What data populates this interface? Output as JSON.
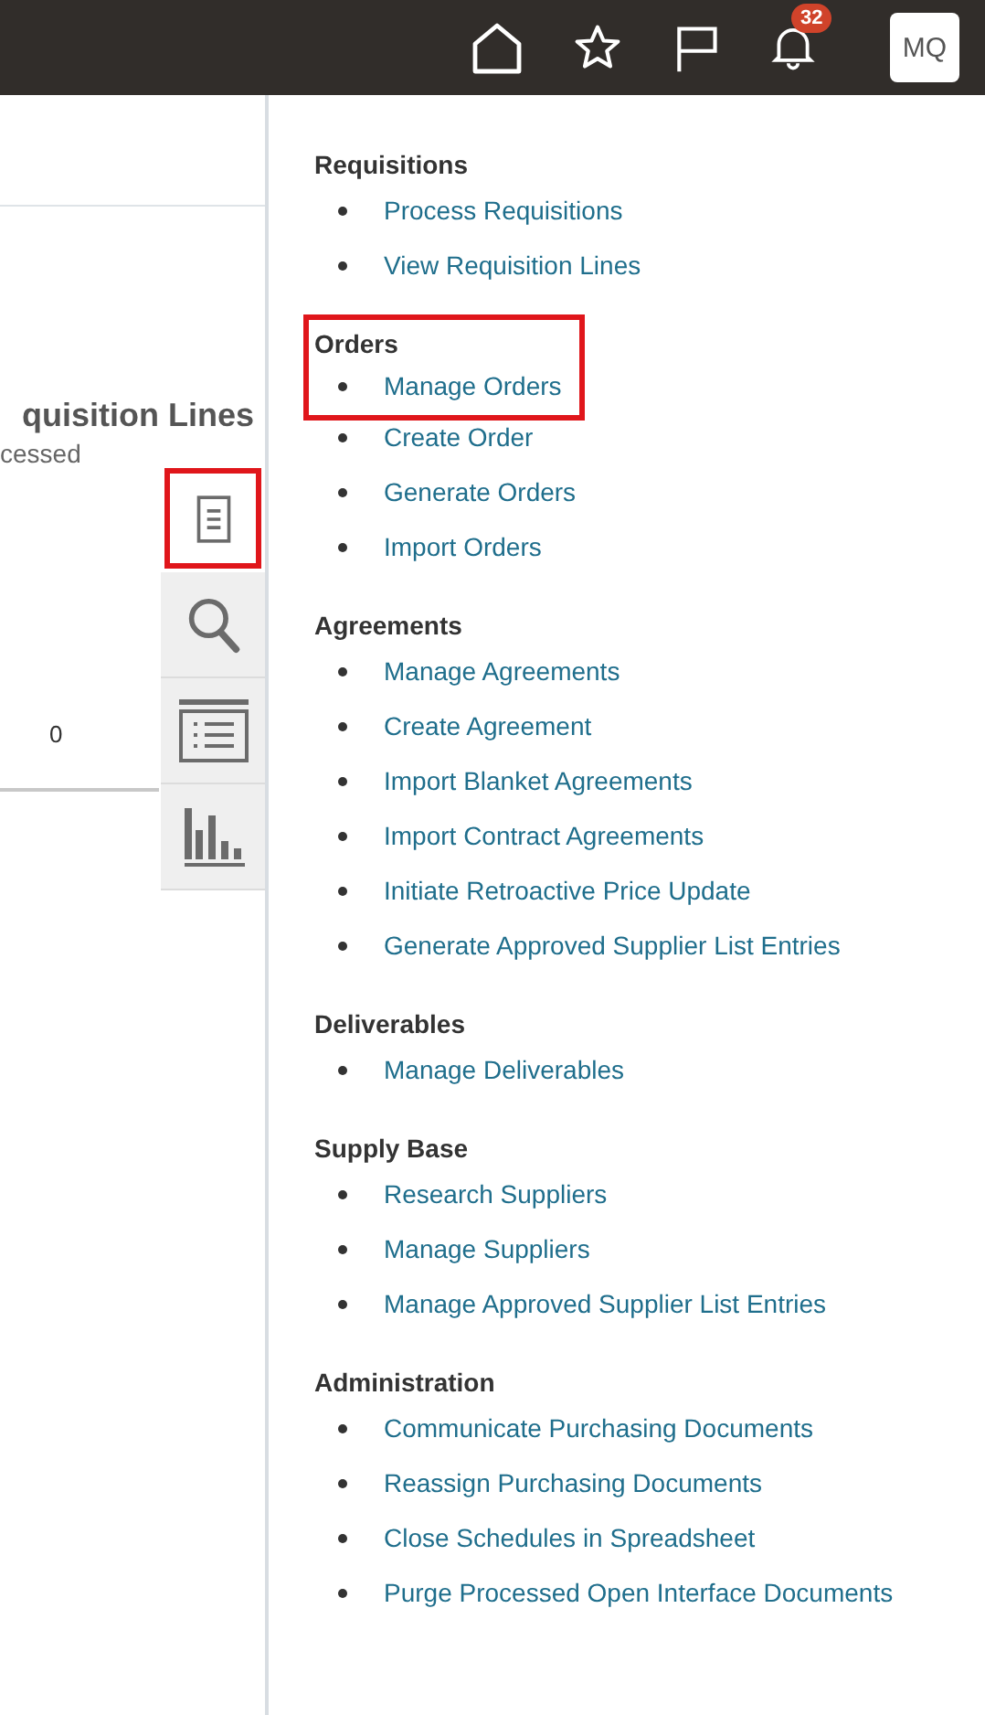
{
  "top_bar": {
    "notification_count": "32",
    "user_initials": "MQ"
  },
  "left_panel": {
    "card_title": "quisition Lines",
    "card_subtitle": "cessed",
    "card_value": "0"
  },
  "side_tabs": [
    {
      "kind": "document",
      "highlighted": true
    },
    {
      "kind": "search",
      "highlighted": false
    },
    {
      "kind": "list",
      "highlighted": false
    },
    {
      "kind": "chart",
      "highlighted": false
    }
  ],
  "menu": [
    {
      "heading": "Requisitions",
      "links": [
        {
          "label": "Process Requisitions"
        },
        {
          "label": "View Requisition Lines"
        }
      ]
    },
    {
      "heading": "Orders",
      "highlighted": true,
      "links": [
        {
          "label": "Manage Orders"
        },
        {
          "label": "Create Order"
        },
        {
          "label": "Generate Orders"
        },
        {
          "label": "Import Orders"
        }
      ]
    },
    {
      "heading": "Agreements",
      "links": [
        {
          "label": "Manage Agreements"
        },
        {
          "label": "Create Agreement"
        },
        {
          "label": "Import Blanket Agreements"
        },
        {
          "label": "Import Contract Agreements"
        },
        {
          "label": "Initiate Retroactive Price Update"
        },
        {
          "label": "Generate Approved Supplier List Entries"
        }
      ]
    },
    {
      "heading": "Deliverables",
      "links": [
        {
          "label": "Manage Deliverables"
        }
      ]
    },
    {
      "heading": "Supply Base",
      "links": [
        {
          "label": "Research Suppliers"
        },
        {
          "label": "Manage Suppliers"
        },
        {
          "label": "Manage Approved Supplier List Entries"
        }
      ]
    },
    {
      "heading": "Administration",
      "links": [
        {
          "label": "Communicate Purchasing Documents"
        },
        {
          "label": "Reassign Purchasing Documents"
        },
        {
          "label": "Close Schedules in Spreadsheet"
        },
        {
          "label": "Purge Processed Open Interface Documents"
        }
      ]
    }
  ]
}
